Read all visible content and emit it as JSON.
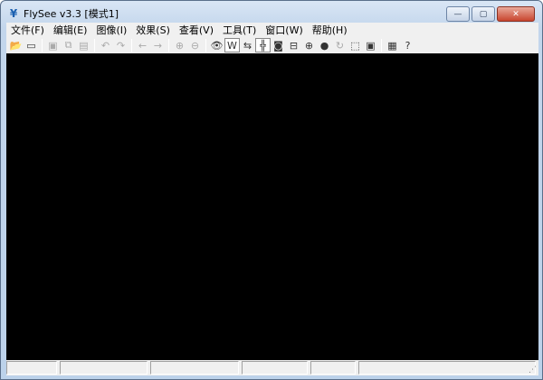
{
  "window": {
    "title": "FlySee v3.3 [模式1]",
    "minimize": "—",
    "maximize": "▢",
    "close": "✕"
  },
  "menu": [
    "文件(F)",
    "编辑(E)",
    "图像(I)",
    "效果(S)",
    "查看(V)",
    "工具(T)",
    "窗口(W)",
    "帮助(H)"
  ],
  "toolbar": [
    {
      "name": "open-icon",
      "glyph": "📂"
    },
    {
      "name": "new-window-icon",
      "glyph": "▭"
    },
    "sep",
    {
      "name": "save-icon",
      "glyph": "▣",
      "dis": true
    },
    {
      "name": "copy-icon",
      "glyph": "⧉",
      "dis": true
    },
    {
      "name": "paste-icon",
      "glyph": "▤",
      "dis": true
    },
    "sep",
    {
      "name": "undo-icon",
      "glyph": "↶",
      "dis": true
    },
    {
      "name": "redo-icon",
      "glyph": "↷",
      "dis": true
    },
    "sep",
    {
      "name": "back-icon",
      "glyph": "←",
      "dis": true
    },
    {
      "name": "forward-icon",
      "glyph": "→",
      "dis": true
    },
    "sep",
    {
      "name": "zoom-in-icon",
      "glyph": "⊕",
      "dis": true
    },
    {
      "name": "zoom-out-icon",
      "glyph": "⊖",
      "dis": true
    },
    "sep",
    {
      "name": "eye-icon",
      "glyph": "👁"
    },
    {
      "name": "w-mode-icon",
      "glyph": "W",
      "pressed": true
    },
    {
      "name": "align-icon",
      "glyph": "⇆"
    },
    {
      "name": "grid-icon",
      "glyph": "╬",
      "pressed": true
    },
    {
      "name": "camera-icon",
      "glyph": "◙"
    },
    {
      "name": "capture-icon",
      "glyph": "⊟"
    },
    {
      "name": "crosshair-icon",
      "glyph": "⊕"
    },
    {
      "name": "device-icon",
      "glyph": "●"
    },
    {
      "name": "refresh-icon",
      "glyph": "↻",
      "dis": true
    },
    {
      "name": "select-icon",
      "glyph": "⬚"
    },
    {
      "name": "portrait-icon",
      "glyph": "▣"
    },
    "sep",
    {
      "name": "clipboard-icon",
      "glyph": "▦"
    },
    {
      "name": "help-icon",
      "glyph": "?"
    }
  ],
  "status": [
    "",
    "",
    "",
    "",
    "",
    ""
  ],
  "resize_grip": "⋰"
}
